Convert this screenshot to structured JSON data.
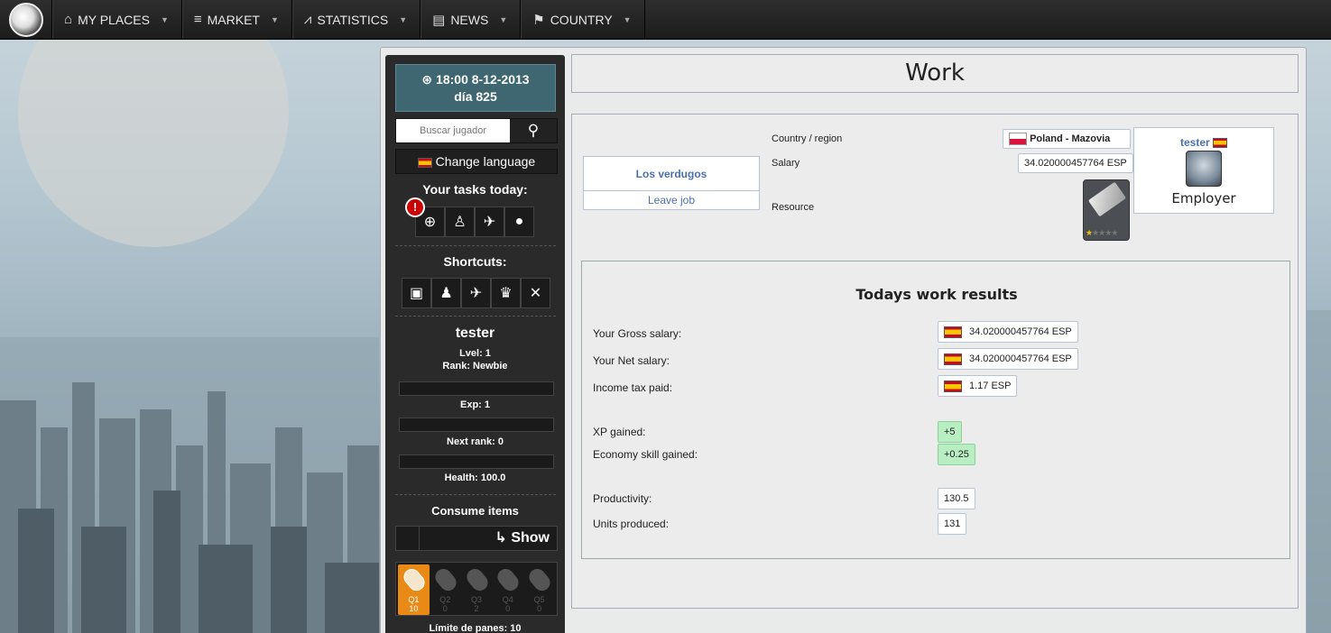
{
  "nav": {
    "items": [
      {
        "icon": "home-icon",
        "glyph": "⌂",
        "label": "MY PLACES"
      },
      {
        "icon": "coins-icon",
        "glyph": "≡",
        "label": "MARKET"
      },
      {
        "icon": "chart-line-icon",
        "glyph": "⩘",
        "label": "STATISTICS"
      },
      {
        "icon": "newspaper-icon",
        "glyph": "▤",
        "label": "NEWS"
      },
      {
        "icon": "flag-icon",
        "glyph": "⚑",
        "label": "COUNTRY"
      }
    ]
  },
  "sidebar": {
    "time": "18:00 8-12-2013",
    "day": "día 825",
    "search_placeholder": "Buscar jugador",
    "change_language": "Change language",
    "tasks_title": "Your tasks today:",
    "alert_glyph": "!",
    "shortcuts_title": "Shortcuts:",
    "player_name": "tester",
    "level": "Lvel: 1",
    "rank": "Rank: Newbie",
    "exp": "Exp:  1",
    "next_rank": "Next rank:  0",
    "health": "Health:  100.0",
    "consume_title": "Consume items",
    "show_label": "Show",
    "breads": [
      {
        "q": "Q1",
        "n": "10"
      },
      {
        "q": "Q2",
        "n": "0"
      },
      {
        "q": "Q3",
        "n": "2"
      },
      {
        "q": "Q4",
        "n": "0"
      },
      {
        "q": "Q5",
        "n": "0"
      }
    ],
    "limit": "Límite de panes: 10"
  },
  "work": {
    "title": "Work",
    "company_name": "Los verdugos",
    "leave_job": "Leave job",
    "country_region_label": "Country / region",
    "country_region_value": "Poland -  Mazovia",
    "salary_label": "Salary",
    "salary_value": "34.020000457764 ESP",
    "resource_label": "Resource",
    "employer_name": "tester",
    "employer_role": "Employer"
  },
  "results": {
    "title": "Todays work results",
    "gross_label": "Your Gross salary:",
    "gross_value": "34.020000457764  ESP",
    "net_label": "Your Net salary:",
    "net_value": "34.020000457764  ESP",
    "tax_label": "Income tax paid:",
    "tax_value": "1.17  ESP",
    "xp_label": "XP gained:",
    "xp_value": "+5",
    "eco_label": "Economy skill gained:",
    "eco_value": "+0.25",
    "prod_label": "Productivity:",
    "prod_value": "130.5",
    "units_label": "Units produced:",
    "units_value": "131"
  }
}
